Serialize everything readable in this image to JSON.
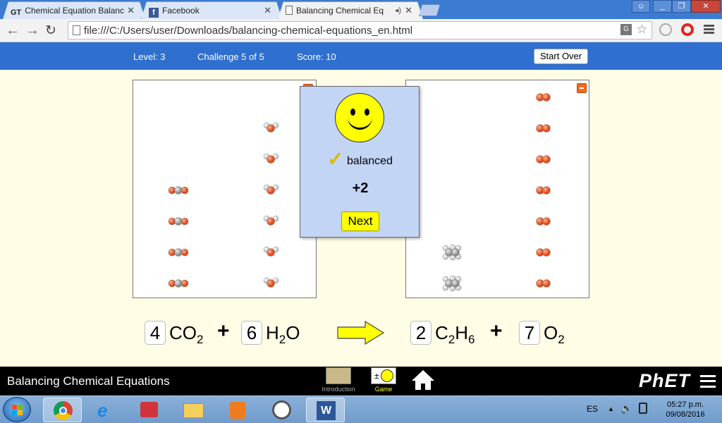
{
  "browser": {
    "tabs": [
      {
        "label": "Chemical Equation Balanc",
        "favicon": "GT"
      },
      {
        "label": "Facebook",
        "favicon": "f"
      },
      {
        "label": "Balancing Chemical Eq",
        "favicon": "page"
      }
    ],
    "close_glyph": "✕",
    "url": "file:///C:/Users/user/Downloads/balancing-chemical-equations_en.html"
  },
  "sim_header": {
    "level": "Level: 3",
    "challenge": "Challenge 5 of 5",
    "score": "Score: 10",
    "start_over": "Start Over"
  },
  "popup": {
    "status": "balanced",
    "points": "+2",
    "next": "Next"
  },
  "equation": {
    "reactants": [
      {
        "coefficient": "4",
        "formula": "CO",
        "sub": "2"
      },
      {
        "coefficient": "6",
        "formula": "H",
        "sub": "2",
        "tail": "O"
      }
    ],
    "products": [
      {
        "coefficient": "2",
        "formula": "C",
        "sub": "2",
        "mid": "H",
        "sub2": "6"
      },
      {
        "coefficient": "7",
        "formula": "O",
        "sub": "2"
      }
    ],
    "plus": "+"
  },
  "molecule_counts": {
    "CO2": 4,
    "H2O": 6,
    "C2H6": 2,
    "O2": 7
  },
  "footer": {
    "title": "Balancing Chemical Equations",
    "screens": [
      "Introduction",
      "Game"
    ],
    "brand": "PhET"
  },
  "taskbar": {
    "language": "ES",
    "time": "05:27 p.m.",
    "date": "09/08/2016"
  },
  "colors": {
    "sim_blue": "#2f6fcf",
    "popup_bg": "#c3d5f5",
    "yellow": "#ffff00",
    "oxygen": "#f05a22",
    "carbon": "#aaaaaa",
    "hydrogen": "#ffffff"
  }
}
